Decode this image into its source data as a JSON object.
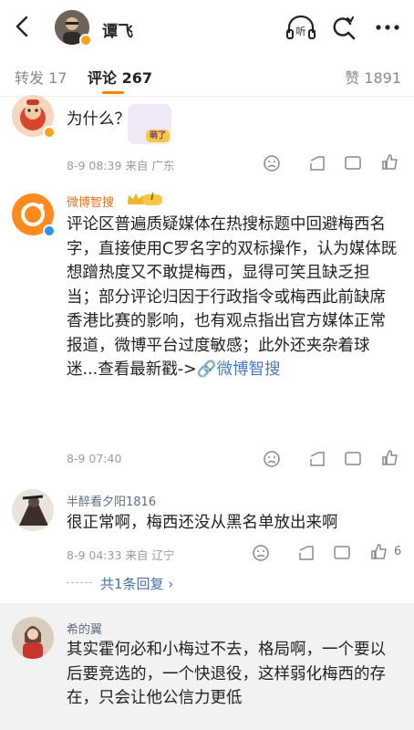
{
  "header": {
    "username": "谭飞",
    "back_icon": "chevron-left-icon",
    "listen_label": "听",
    "icons": [
      "listen-icon",
      "search-refresh-icon",
      "more-icon"
    ]
  },
  "tabs": [
    {
      "label": "转发 17"
    },
    {
      "label": "评论 267"
    },
    {
      "label": "赞 1891"
    }
  ],
  "comments": [
    {
      "text": "为什么？",
      "sticker_text": "萌了",
      "meta": "8-9 08:39  来自 广东"
    },
    {
      "name": "微博智搜",
      "badge": "i",
      "text_main": "评论区普遍质疑媒体在热搜标题中回避梅西名字，直接使用C罗名字的双标操作，认为媒体既想蹭热度又不敢提梅西，显得可笑且缺乏担当；部分评论归因于行政指令或梅西此前缺席香港比赛的影响，也有观点指出官方媒体正常报道，微博平台过度敏感；此外还夹杂着球迷...查看最新戳->",
      "text_link": "🔗微博智搜",
      "meta": "8-9 07:40"
    },
    {
      "name": "半醉看夕阳1816",
      "text": "很正常啊，梅西还没从黑名单放出来啊",
      "meta": "8-9 04:33  来自 辽宁",
      "likes": "6",
      "replies": "共1条回复 ›"
    },
    {
      "name": "希的翼",
      "text": "其实霍何必和小梅过不去，格局啊，一个要以后要竞选的，一个快退役，这样弱化梅西的存在，只会让他公信力更低"
    }
  ],
  "colors": {
    "accent": "#ff8200",
    "link": "#4a7ac7",
    "name": "#5d6d86",
    "verified": "#f7a21b"
  }
}
